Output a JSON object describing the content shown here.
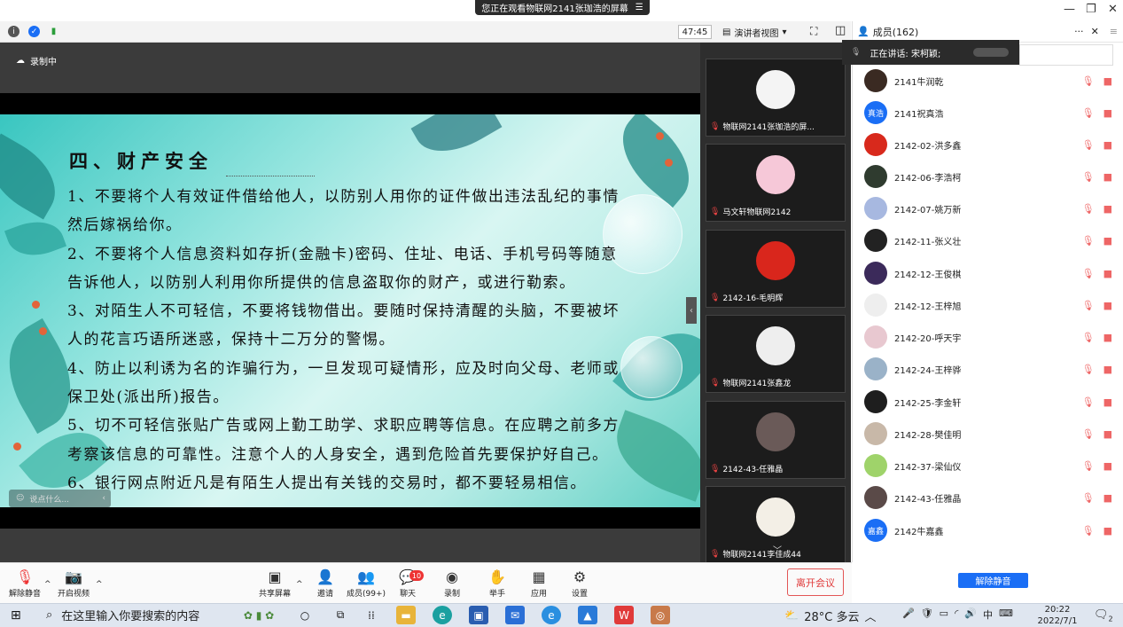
{
  "window": {
    "share_banner": "您正在观看物联网2141张珈浩的屏幕",
    "share_menu_icon": "menu-icon",
    "minimize": "—",
    "restore": "❐",
    "close": "✕"
  },
  "toolbar": {
    "timer": "47:45",
    "view_label": "演讲者视图",
    "members_title": "成员(162)"
  },
  "stage": {
    "recording": "录制中",
    "chat_placeholder": "说点什么...",
    "slide": {
      "title": "四、财产安全",
      "lines": [
        "1、不要将个人有效证件借给他人，以防别人用你的证件做出违法乱纪的事情然后嫁祸给你。",
        "2、不要将个人信息资料如存折(金融卡)密码、住址、电话、手机号码等随意告诉他人，以防别人利用你所提供的信息盗取你的财产，或进行勒索。",
        "3、对陌生人不可轻信，不要将钱物借出。要随时保持清醒的头脑，不要被坏人的花言巧语所迷惑，保持十二万分的警惕。",
        "4、防止以利诱为名的诈骗行为，一旦发现可疑情形，应及时向父母、老师或保卫处(派出所)报告。",
        "5、切不可轻信张贴广告或网上勤工助学、求职应聘等信息。在应聘之前多方考察该信息的可靠性。注意个人的人身安全，遇到危险首先要保护好自己。",
        "6、银行网点附近凡是有陌生人提出有关钱的交易时，都不要轻易相信。"
      ]
    }
  },
  "video_tiles": [
    {
      "name": "物联网2141张珈浩的屏...",
      "color": "#f4f4f4"
    },
    {
      "name": "马文轩物联网2142",
      "color": "#f6c8d8"
    },
    {
      "name": "2142-16-毛明辉",
      "color": "#d9261c"
    },
    {
      "name": "物联网2141张鑫龙",
      "color": "#eeeeee"
    },
    {
      "name": "2142-43-任雅晶",
      "color": "#6a5a58"
    },
    {
      "name": "物联网2141李佳成44",
      "color": "#f3efe6"
    }
  ],
  "speaking": "正在讲话: 宋柯颖;",
  "members": [
    {
      "name": "2141牛润乾",
      "avatar": "",
      "color": "#3a2a22"
    },
    {
      "name": "2141祝真浩",
      "avatar": "真浩",
      "color": "#1a6ef5"
    },
    {
      "name": "2142-02-洪多鑫",
      "avatar": "",
      "color": "#d8291c"
    },
    {
      "name": "2142-06-李浩柯",
      "avatar": "",
      "color": "#2f3b2f"
    },
    {
      "name": "2142-07-姚万新",
      "avatar": "",
      "color": "#a7b8e0"
    },
    {
      "name": "2142-11-张义壮",
      "avatar": "",
      "color": "#222222"
    },
    {
      "name": "2142-12-王俊棋",
      "avatar": "",
      "color": "#3b2a5a"
    },
    {
      "name": "2142-12-王梓旭",
      "avatar": "",
      "color": "#eeeeee"
    },
    {
      "name": "2142-20-呼天宇",
      "avatar": "",
      "color": "#e8c8d0"
    },
    {
      "name": "2142-24-王梓骅",
      "avatar": "",
      "color": "#9ab2c8"
    },
    {
      "name": "2142-25-李金轩",
      "avatar": "",
      "color": "#1e1e1e"
    },
    {
      "name": "2142-28-樊佳明",
      "avatar": "",
      "color": "#c8b8a8"
    },
    {
      "name": "2142-37-梁仙仪",
      "avatar": "",
      "color": "#9fd36a"
    },
    {
      "name": "2142-43-任雅晶",
      "avatar": "",
      "color": "#5a4a48"
    },
    {
      "name": "2142牛嘉鑫",
      "avatar": "嘉鑫",
      "color": "#1a6ef5"
    }
  ],
  "unmute_all": "解除静音",
  "controls": {
    "unmute": "解除静音",
    "video": "开启视频",
    "share": "共享屏幕",
    "invite": "邀请",
    "members": "成员(99+)",
    "chat": "聊天",
    "chat_badge": "10",
    "record": "录制",
    "raise_hand": "举手",
    "apps": "应用",
    "settings": "设置",
    "leave": "离开会议"
  },
  "taskbar": {
    "search_placeholder": "在这里输入你要搜索的内容",
    "weather": "28°C 多云",
    "ime": "中",
    "time": "20:22",
    "date": "2022/7/1",
    "notify_count": "2"
  }
}
